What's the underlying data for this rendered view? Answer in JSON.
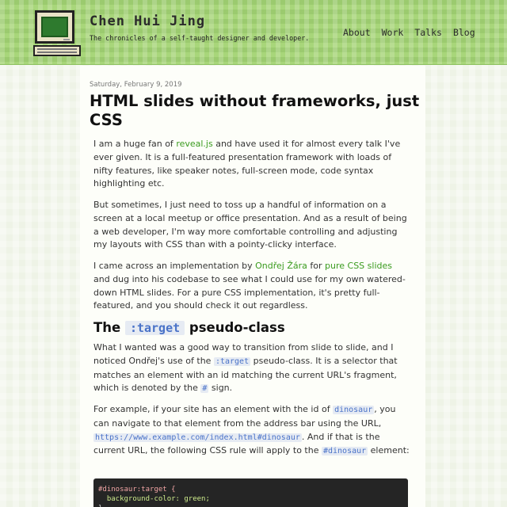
{
  "site": {
    "title": "Chen Hui Jing",
    "tagline": "The chronicles of a self-taught designer and developer."
  },
  "nav": [
    "About",
    "Work",
    "Talks",
    "Blog"
  ],
  "post": {
    "date": "Saturday, February 9, 2019",
    "title": "HTML slides without frameworks, just CSS",
    "p1": [
      "I am a huge fan of ",
      "reveal.js",
      " and have used it for almost every talk I've ever given. It is a full-featured presentation framework with loads of nifty features, like speaker notes, full-screen mode, code syntax highlighting etc."
    ],
    "p2": "But sometimes, I just need to toss up a handful of information on a screen at a local meetup or office presentation. And as a result of being a web developer, I'm way more comfortable controlling and adjusting my layouts with CSS than with a pointy-clicky interface.",
    "p3": [
      "I came across an implementation by ",
      "Ondřej Žára",
      " for ",
      "pure CSS slides",
      " and dug into his codebase to see what I could use for my own watered-down HTML slides. For a pure CSS implementation, it's pretty full-featured, and you should check it out regardless."
    ],
    "h2": [
      "The ",
      ":target",
      " pseudo-class"
    ],
    "p4": [
      "What I wanted was a good way to transition from slide to slide, and I noticed Ondřej's use of the ",
      ":target",
      " pseudo-class. It is a selector that matches an element with an id matching the current URL's fragment, which is denoted by the ",
      "#",
      " sign."
    ],
    "p5": [
      "For example, if your site has an element with the id of ",
      "dinosaur",
      ", you can navigate to that element from the address bar using the URL, ",
      "https://www.example.com/index.html#dinosaur",
      ". And if that is the current URL, the following CSS rule will apply to the ",
      "#dinosaur",
      " element:"
    ],
    "code": [
      "#dinosaur:target {",
      "  background-color: green;",
      "}"
    ]
  }
}
